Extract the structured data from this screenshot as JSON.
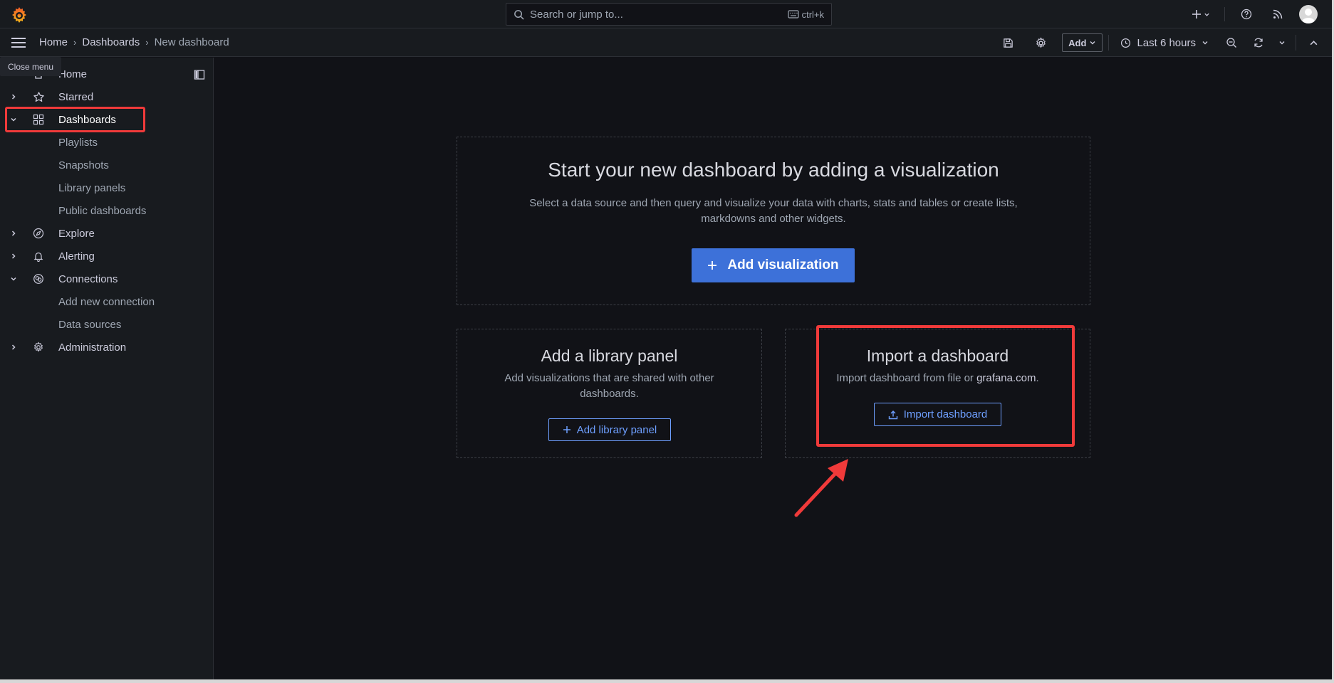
{
  "topbar": {
    "search_placeholder": "Search or jump to...",
    "search_shortcut": "ctrl+k",
    "icons": [
      "grafana-logo",
      "plus-icon",
      "help-icon",
      "news-icon",
      "user-avatar"
    ]
  },
  "subbar": {
    "breadcrumb": [
      "Home",
      "Dashboards",
      "New dashboard"
    ],
    "add_label": "Add",
    "time_range": "Last 6 hours"
  },
  "sidebar": {
    "tooltip": "Close menu",
    "items": [
      {
        "label": "Home",
        "icon": "home-icon",
        "chevron": ""
      },
      {
        "label": "Starred",
        "icon": "star-icon",
        "chevron": "right"
      },
      {
        "label": "Dashboards",
        "icon": "apps-icon",
        "chevron": "down"
      },
      {
        "label": "Playlists"
      },
      {
        "label": "Snapshots"
      },
      {
        "label": "Library panels"
      },
      {
        "label": "Public dashboards"
      },
      {
        "label": "Explore",
        "icon": "compass-icon",
        "chevron": "right"
      },
      {
        "label": "Alerting",
        "icon": "bell-icon",
        "chevron": "right"
      },
      {
        "label": "Connections",
        "icon": "link-icon",
        "chevron": "down"
      },
      {
        "label": "Add new connection"
      },
      {
        "label": "Data sources"
      },
      {
        "label": "Administration",
        "icon": "cog-icon",
        "chevron": "right"
      }
    ]
  },
  "main": {
    "hero": {
      "title": "Start your new dashboard by adding a visualization",
      "desc_line1": "Select a data source and then query and visualize your data with charts, stats and tables or create lists,",
      "desc_line2": "markdowns and other widgets.",
      "button": "Add visualization"
    },
    "library": {
      "title": "Add a library panel",
      "desc_line1": "Add visualizations that are shared with other",
      "desc_line2": "dashboards.",
      "button": "Add library panel"
    },
    "import": {
      "title": "Import a dashboard",
      "desc_prefix": "Import dashboard from file or ",
      "desc_link": "grafana.com",
      "desc_suffix": ".",
      "button": "Import dashboard"
    }
  },
  "colors": {
    "background": "#111217",
    "panel": "#181b1f",
    "primary": "#3d71d9",
    "annotation": "#f03a3a"
  }
}
